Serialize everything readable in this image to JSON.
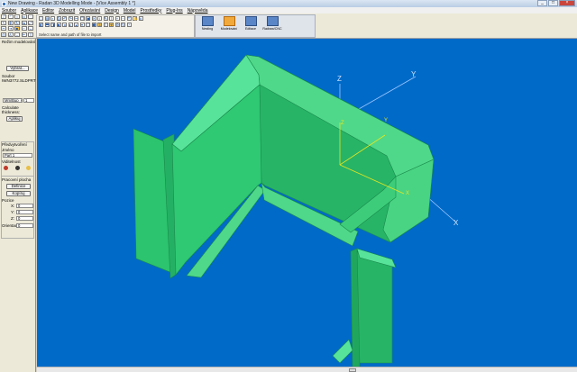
{
  "window": {
    "title": "New Drawing - Radan 3D Modelling Mode - [Více Assembly 1 *]"
  },
  "window_buttons": {
    "minimize": "_",
    "maximize": "□",
    "close": "×"
  },
  "menu": [
    "Soubor",
    "Aplikace",
    "Editor",
    "Zobrazit",
    "Ořezávání",
    "Design",
    "Model",
    "Prostředky",
    "Plug-Ins",
    "Nápověda"
  ],
  "toolbar": {
    "status_hint": "Select name and path of file to import",
    "big_buttons": [
      "Nesting",
      "Modelování",
      "Editace",
      "Radraw/CNC"
    ]
  },
  "sidebar": {
    "header": "Režim modelování",
    "open_button": "Vybrat...",
    "file_label": "Soubor",
    "file_value": "IWN3772.SLDPRT",
    "units_value": "Mm/Bup_sl",
    "units_number": "1",
    "calc_label": "Calculate",
    "calc_label2": "thickness:",
    "apply_button": "Aplikuj",
    "group1_title": "Předvytvoření",
    "name_label": "Jméno",
    "name_value": "Part 1",
    "visibility_label": "Viditelnost",
    "group2_title": "Pracovní plocha",
    "define_button": "Definice",
    "copy_button": "Kopíruj",
    "position_label": "Pozice",
    "x_label": "X:",
    "y_label": "Y:",
    "z_label": "Z:",
    "x_value": "0",
    "y_value": "0",
    "z_value": "0",
    "orientation_label": "Orientace",
    "orientation_value": "0"
  },
  "axes": {
    "x": "X",
    "y": "Y",
    "z": "Z"
  },
  "colors": {
    "viewport": "#006ac8",
    "part_top": "#58e39a",
    "part_front": "#2cc46e",
    "part_dark": "#20a75d",
    "axis": "#e6e61e"
  }
}
